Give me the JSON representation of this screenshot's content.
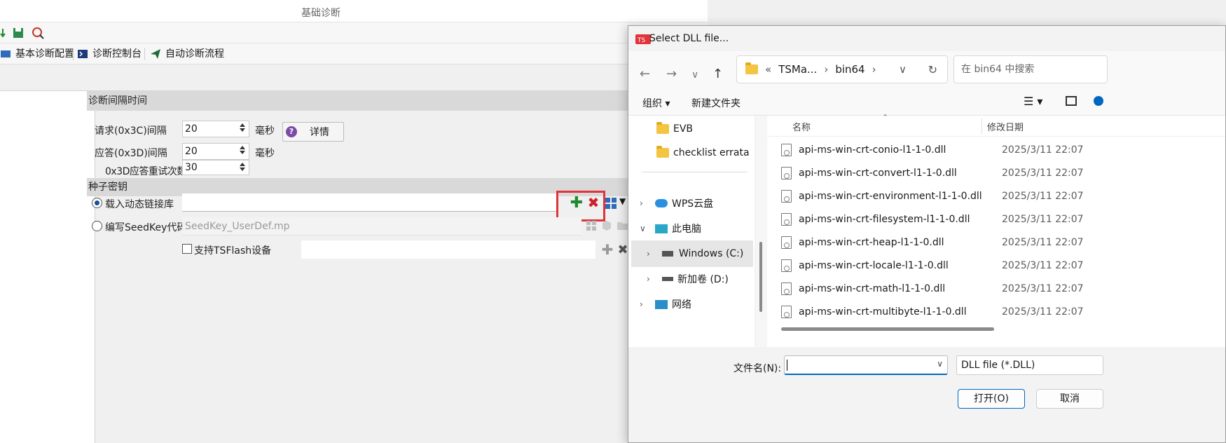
{
  "app": {
    "title": "基础诊断",
    "close_glyph": "✕",
    "tabs": [
      {
        "label": "基本诊断配置"
      },
      {
        "label": "诊断控制台"
      },
      {
        "label": "自动诊断流程"
      }
    ],
    "interval_section": {
      "header": "诊断间隔时间",
      "request_label": "请求(0x3C)间隔",
      "request_value": "20",
      "response_label": "应答(0x3D)间隔",
      "response_value": "20",
      "unit": "毫秒",
      "unit2": "毫秒",
      "retry_label": "0x3D应答重试次数",
      "retry_value": "30",
      "detail_button": "详情"
    },
    "seed_section": {
      "header": "种子密钥",
      "load_dll_label": "载入动态链接库",
      "write_seedkey_label": "编写SeedKey代码",
      "seedkey_file": "SeedKey_UserDef.mp",
      "tsflash_label": "支持TSFlash设备"
    }
  },
  "dialog": {
    "title": "Select DLL file...",
    "breadcrumb": [
      "«",
      "TSMa...",
      "›",
      "bin64",
      "›"
    ],
    "search_placeholder": "在 bin64 中搜索",
    "commands": {
      "organize": "组织 ▾",
      "new_folder": "新建文件夹"
    },
    "tree": [
      {
        "label": "EVB",
        "icon": "folder"
      },
      {
        "label": "checklist errata",
        "icon": "folder"
      },
      {
        "label": "WPS云盘",
        "icon": "cloud"
      },
      {
        "label": "此电脑",
        "icon": "computer"
      },
      {
        "label": "Windows (C:)",
        "icon": "drive",
        "selected": true
      },
      {
        "label": "新加卷 (D:)",
        "icon": "drive"
      },
      {
        "label": "网络",
        "icon": "network"
      }
    ],
    "columns": {
      "name": "名称",
      "date": "修改日期"
    },
    "files": [
      {
        "name": "api-ms-win-crt-conio-l1-1-0.dll",
        "date": "2025/3/11 22:07"
      },
      {
        "name": "api-ms-win-crt-convert-l1-1-0.dll",
        "date": "2025/3/11 22:07"
      },
      {
        "name": "api-ms-win-crt-environment-l1-1-0.dll",
        "date": "2025/3/11 22:07"
      },
      {
        "name": "api-ms-win-crt-filesystem-l1-1-0.dll",
        "date": "2025/3/11 22:07"
      },
      {
        "name": "api-ms-win-crt-heap-l1-1-0.dll",
        "date": "2025/3/11 22:07"
      },
      {
        "name": "api-ms-win-crt-locale-l1-1-0.dll",
        "date": "2025/3/11 22:07"
      },
      {
        "name": "api-ms-win-crt-math-l1-1-0.dll",
        "date": "2025/3/11 22:07"
      },
      {
        "name": "api-ms-win-crt-multibyte-l1-1-0.dll",
        "date": "2025/3/11 22:07"
      }
    ],
    "filename_label": "文件名(N):",
    "filename_value": "",
    "filter": "DLL file (*.DLL)",
    "open_button": "打开(O)",
    "cancel_button": "取消"
  },
  "colors": {
    "accent": "#0067c0",
    "highlight_box": "#e0333a",
    "add_green": "#1f8a2e",
    "remove_red": "#d0202a"
  }
}
